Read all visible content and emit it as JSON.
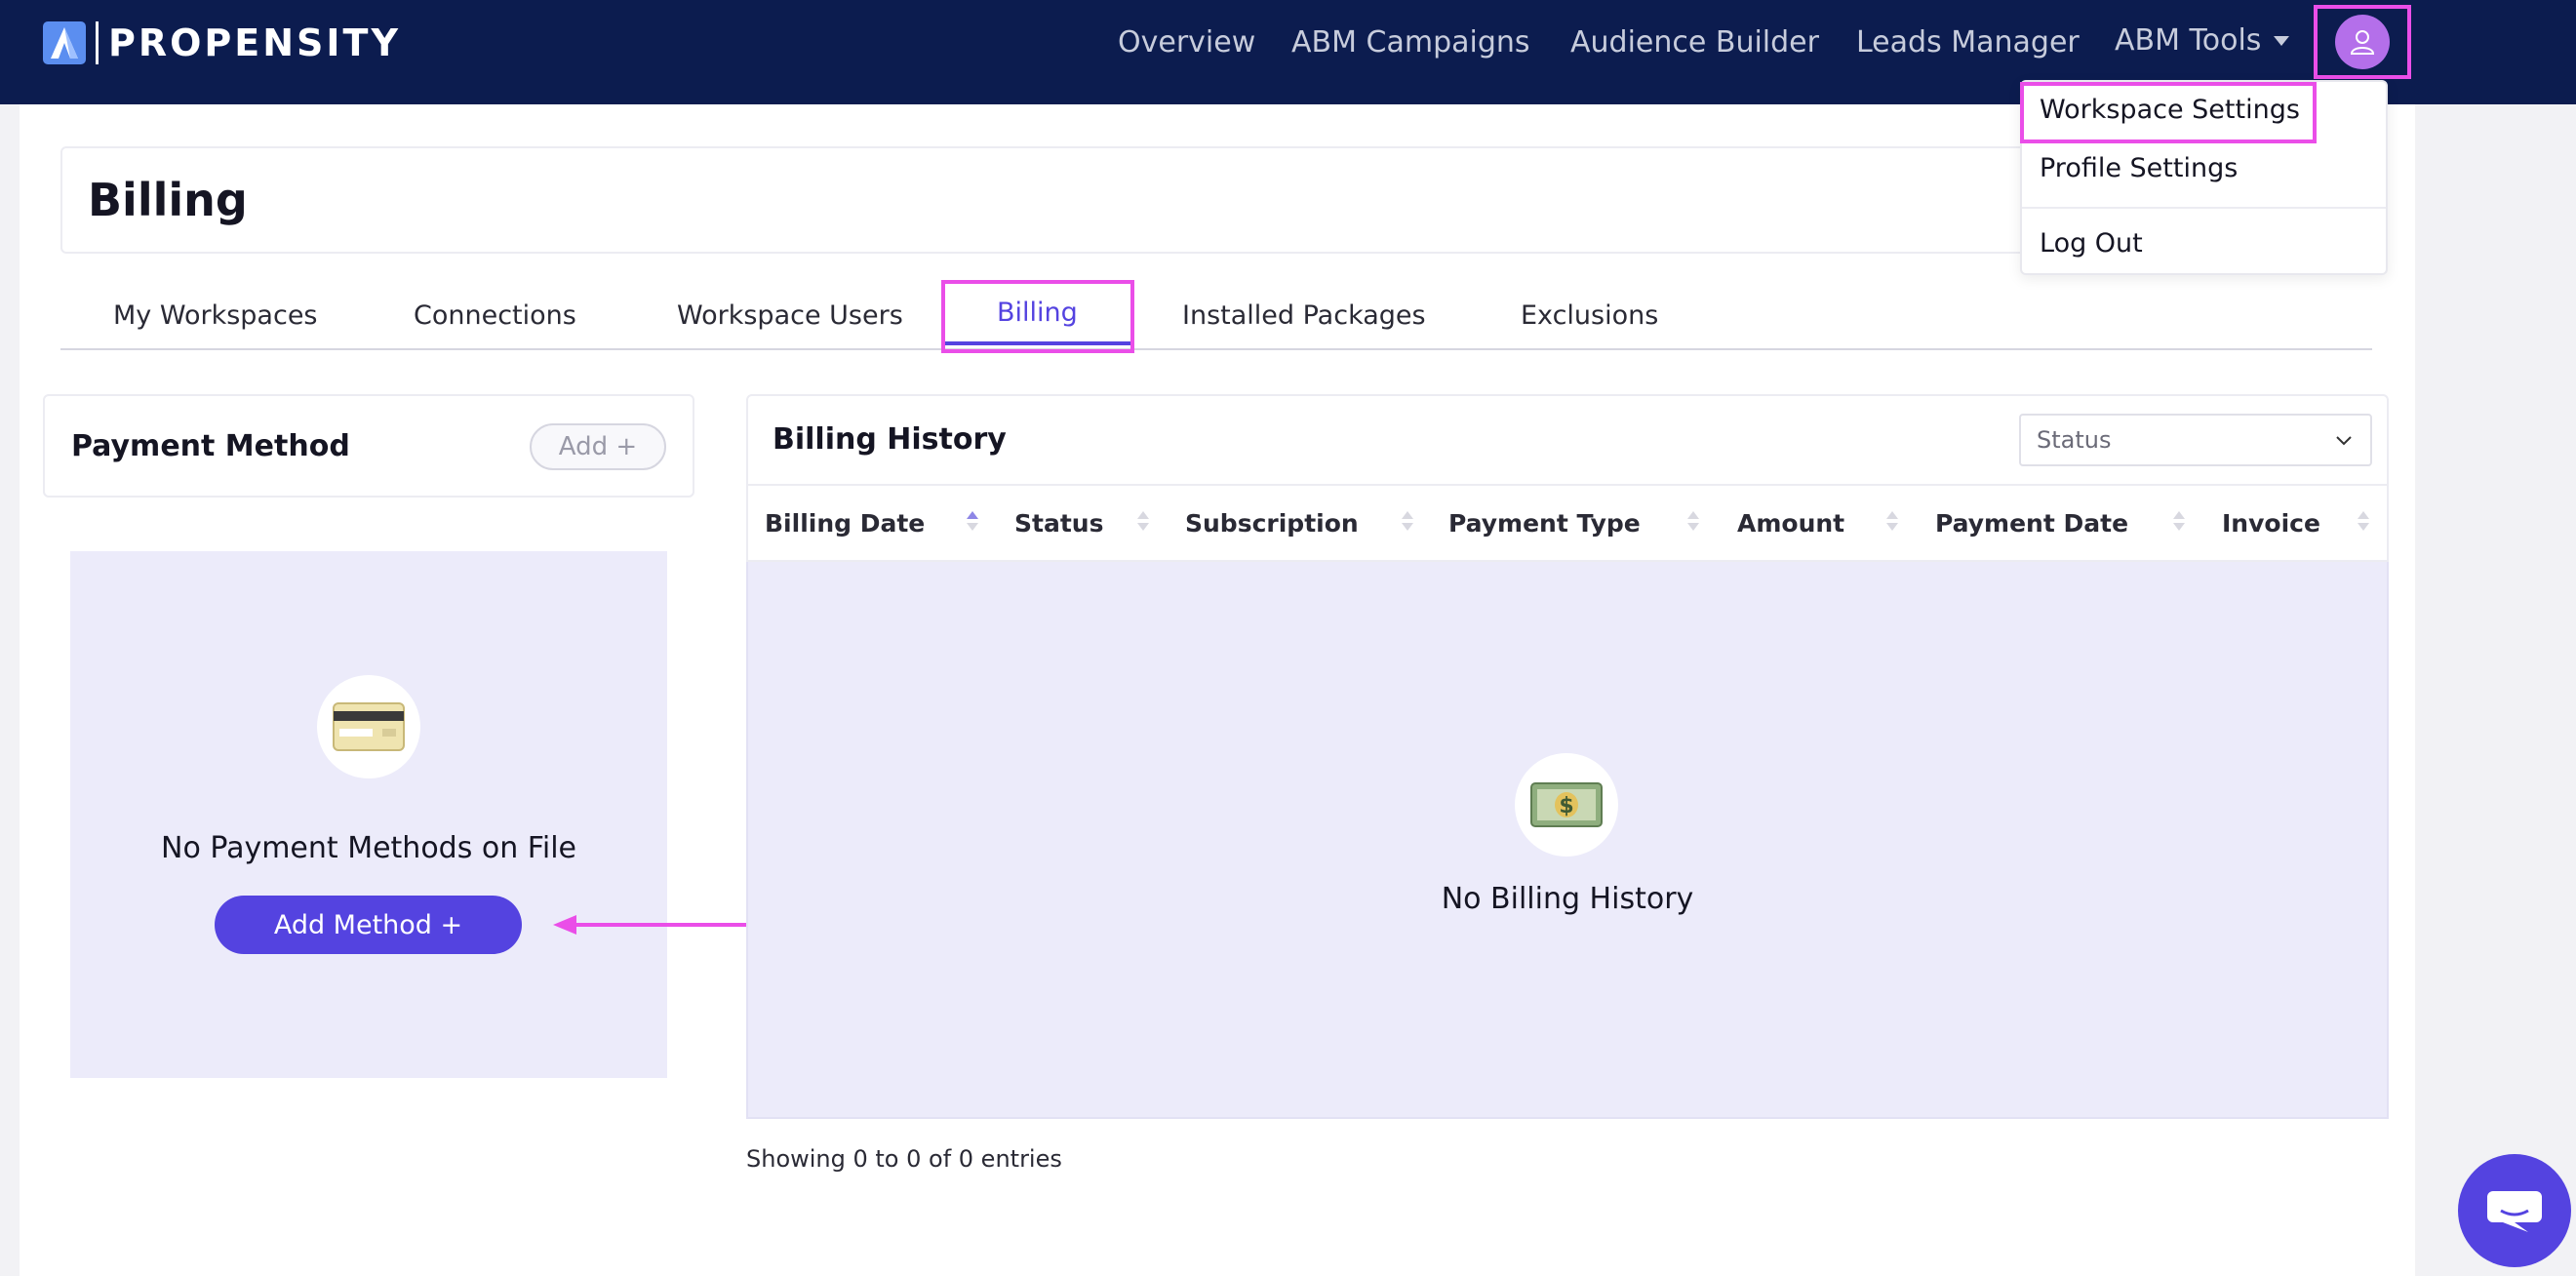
{
  "brand": {
    "name": "PROPENSITY"
  },
  "nav": {
    "items": [
      "Overview",
      "ABM Campaigns",
      "Audience Builder",
      "Leads Manager",
      "ABM Tools"
    ]
  },
  "user_menu": {
    "items": [
      "Workspace Settings",
      "Profile Settings",
      "Log Out"
    ]
  },
  "page": {
    "title": "Billing"
  },
  "tabs": [
    "My Workspaces",
    "Connections",
    "Workspace Users",
    "Billing",
    "Installed Packages",
    "Exclusions"
  ],
  "payment_method": {
    "title": "Payment Method",
    "add_label": "Add +",
    "empty_text": "No Payment Methods on File",
    "add_method_label": "Add Method +",
    "icon": "credit-card-icon"
  },
  "billing_history": {
    "title": "Billing History",
    "status_filter": "Status",
    "columns": [
      "Billing Date",
      "Status",
      "Subscription",
      "Payment Type",
      "Amount",
      "Payment Date",
      "Invoice"
    ],
    "empty_text": "No Billing History",
    "entries_text": "Showing 0 to 0 of 0 entries",
    "icon": "money-icon"
  },
  "colors": {
    "nav_bg": "#0c1c4f",
    "accent": "#5443e0",
    "highlight": "#ea4ee8",
    "empty_bg": "#ecebfa"
  }
}
